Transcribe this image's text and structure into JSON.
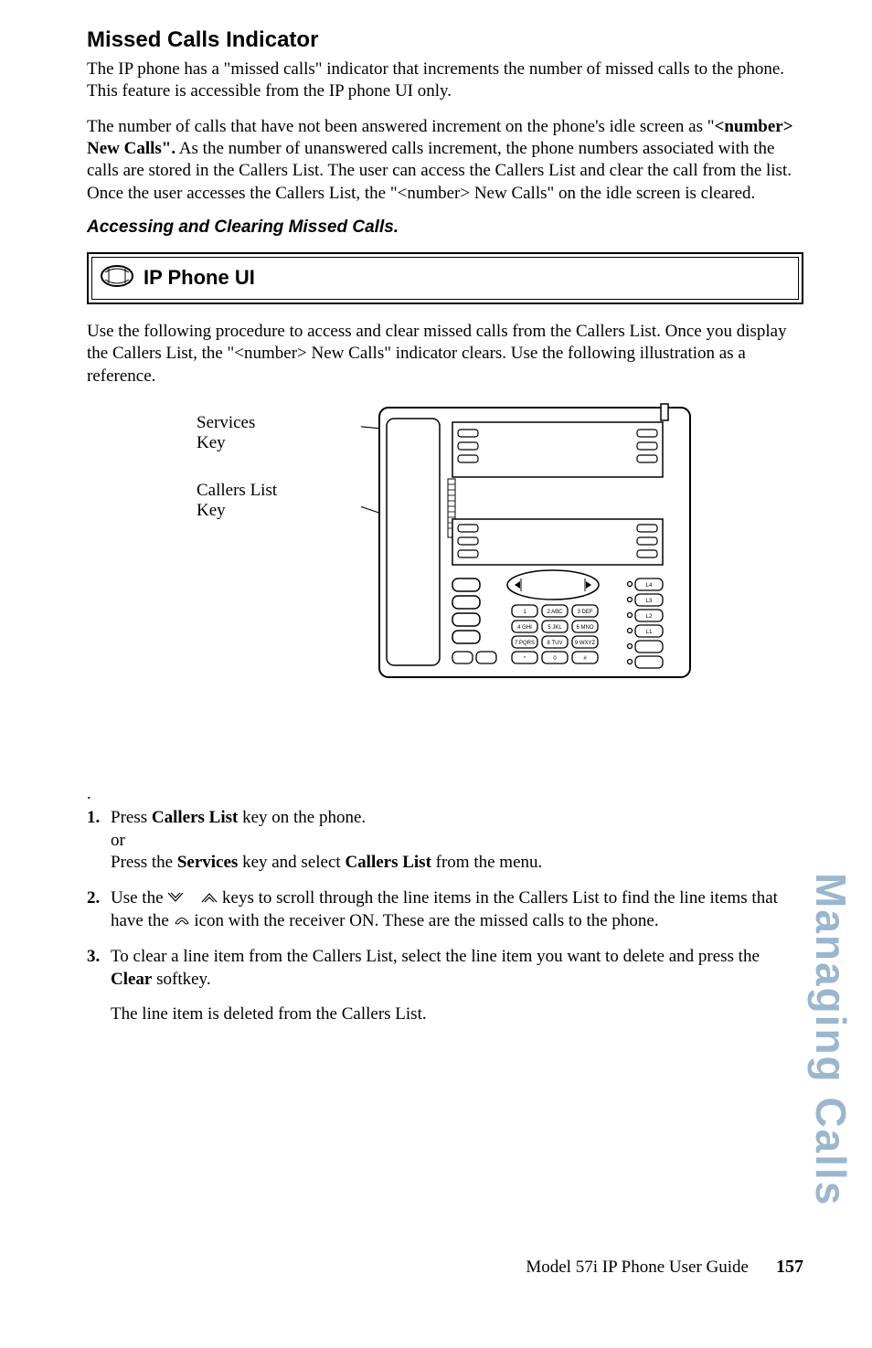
{
  "title": "Missed Calls Indicator",
  "para1": "The IP phone has a \"missed calls\" indicator that increments the number of missed calls to the phone. This feature is accessible from the IP phone UI only.",
  "para2_lead": "The number of calls that have not been answered increment on the phone's idle screen as \"",
  "para2_bold": "<number> New Calls\".",
  "para2_tail": " As the number of unanswered calls increment, the phone numbers associated with the calls are stored in the Callers List. The user can access the Callers List and clear the call from the list. Once the user accesses the Callers List, the \"<number> New Calls\" on the idle screen is cleared.",
  "subheading": "Accessing and Clearing Missed Calls.",
  "uibox": {
    "label": "IP Phone UI"
  },
  "para3": "Use the following procedure to access and clear missed calls from the Callers List. Once you display the Callers List, the \"<number> New Calls\" indicator clears. Use the following illustration as a reference.",
  "illus": {
    "services_label_l1": "Services",
    "services_label_l2": "Key",
    "callers_label_l1": "Callers List",
    "callers_label_l2": "Key"
  },
  "steps": {
    "s1_a": "Press ",
    "s1_b": "Callers List",
    "s1_c": " key on the phone.",
    "s1_or": "or",
    "s1_d": "Press the ",
    "s1_e": "Services",
    "s1_f": " key and select ",
    "s1_g": "Callers List",
    "s1_h": " from the menu.",
    "s2_a": "Use the ",
    "s2_b": " keys to scroll through the line items in the Callers List to find the line items that have the ",
    "s2_c": " icon with the receiver ON. These are the missed calls to the phone.",
    "s3_a": "To clear a line item from the Callers List, select the line item you want to delete and press the ",
    "s3_b": "Clear",
    "s3_c": " softkey.",
    "s3_d": "The line item is deleted from the Callers List."
  },
  "sidetab": "Managing Calls",
  "footer": {
    "title": "Model 57i IP Phone User Guide",
    "page": "157"
  }
}
